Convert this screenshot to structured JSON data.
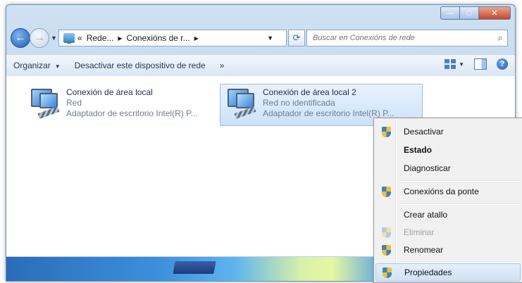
{
  "window": {
    "caption_buttons": {
      "minimize": "—",
      "maximize": "□",
      "close": "✕"
    }
  },
  "nav": {
    "back_glyph": "←",
    "forward_glyph": "→",
    "dropdown_glyph": "▼",
    "address": {
      "prefix": "«",
      "crumbs": [
        "Rede...",
        "Conexións de r..."
      ],
      "separator": "▶",
      "dropdown_glyph": "▼"
    },
    "refresh_glyph": "⟳",
    "search": {
      "placeholder": "Buscar en Conexións de rede",
      "icon_glyph": "⌕"
    }
  },
  "toolbar": {
    "organize": "Organizar",
    "disable_device": "Desactivar este dispositivo de rede",
    "more": "»",
    "dropdown_glyph": "▼",
    "help_glyph": "?"
  },
  "connections": [
    {
      "name": "Conexión de área local",
      "status": "Red",
      "adapter": "Adaptador de escritorio Intel(R) P...",
      "selected": false
    },
    {
      "name": "Conexión de área local 2",
      "status": "Red no identificada",
      "adapter": "Adaptador de escritorio Intel(R) P...",
      "selected": true
    }
  ],
  "context_menu": {
    "items": [
      {
        "label": "Desactivar",
        "icon": "uac-shield-icon",
        "bold": false,
        "disabled": false
      },
      {
        "label": "Estado",
        "icon": "",
        "bold": true,
        "disabled": false
      },
      {
        "label": "Diagnosticar",
        "icon": "",
        "bold": false,
        "disabled": false
      },
      {
        "label": "Conexións da ponte",
        "icon": "uac-shield-icon",
        "bold": false,
        "disabled": false
      },
      {
        "label": "Crear atallo",
        "icon": "",
        "bold": false,
        "disabled": false
      },
      {
        "label": "Eliminar",
        "icon": "uac-shield-icon",
        "bold": false,
        "disabled": true
      },
      {
        "label": "Renomear",
        "icon": "uac-shield-icon",
        "bold": false,
        "disabled": false
      },
      {
        "label": "Propiedades",
        "icon": "uac-shield-icon",
        "bold": false,
        "disabled": false,
        "highlighted": true
      }
    ]
  },
  "colors": {
    "accent": "#2a6bc0",
    "selection": "#cde2f9",
    "menu_background": "#f1f1f1",
    "close_button": "#c7452b"
  }
}
